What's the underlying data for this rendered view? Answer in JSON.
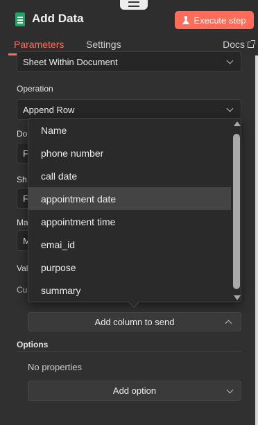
{
  "header": {
    "title": "Add Data",
    "execute_label": "Execute step",
    "tabs": [
      "Parameters",
      "Settings"
    ],
    "docs_label": "Docs"
  },
  "fields": {
    "sheet_within_value": "Sheet Within Document",
    "operation_label": "Operation",
    "operation_value": "Append Row",
    "partial": [
      {
        "label": "Do",
        "value": "F"
      },
      {
        "label": "Sh",
        "value": "F"
      },
      {
        "label": "Ma",
        "value": "M"
      },
      {
        "label": "Val"
      },
      {
        "label": "Cu"
      }
    ]
  },
  "dropdown": {
    "options": [
      "Name",
      "phone number",
      "call date",
      "appointment date",
      "appointment time",
      "emai_id",
      "purpose",
      "summary"
    ],
    "highlighted": "appointment date"
  },
  "add_column_label": "Add column to send",
  "options_section": {
    "label": "Options",
    "empty_text": "No properties",
    "add_option_label": "Add option"
  },
  "colors": {
    "accent": "#ff6d5a",
    "background": "#303030",
    "sheets_green": "#21a366"
  }
}
